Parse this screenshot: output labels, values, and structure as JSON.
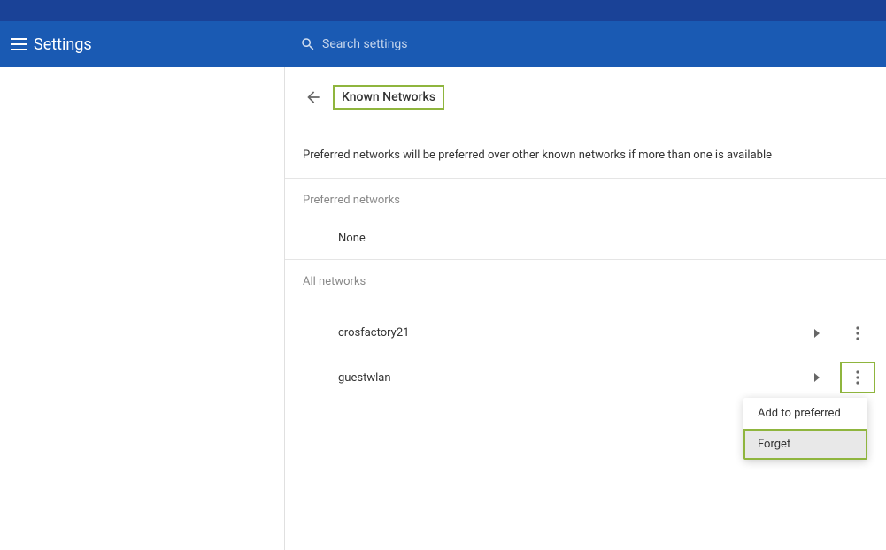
{
  "header": {
    "title": "Settings",
    "searchPlaceholder": "Search settings"
  },
  "page": {
    "title": "Known Networks",
    "description": "Preferred networks will be preferred over other known networks if more than one is available"
  },
  "sections": {
    "preferredHeader": "Preferred networks",
    "preferredNone": "None",
    "allHeader": "All networks"
  },
  "networks": [
    {
      "name": "crosfactory21"
    },
    {
      "name": "guestwlan"
    }
  ],
  "contextMenu": {
    "addToPreferred": "Add to preferred",
    "forget": "Forget"
  }
}
